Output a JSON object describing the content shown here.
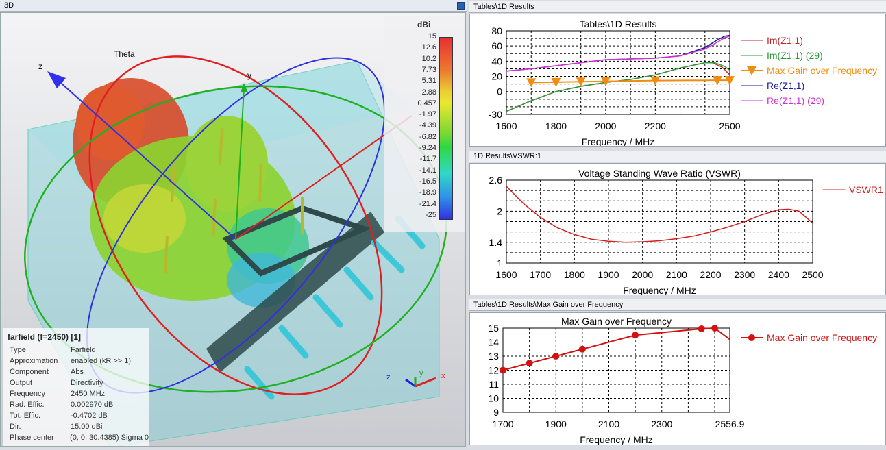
{
  "view3d": {
    "title": "3D",
    "axis_label_theta": "Theta",
    "axis_z": "z",
    "axis_y": "y",
    "axis_x": "x",
    "colorbar": {
      "unit": "dBi",
      "ticks": [
        "15",
        "12.6",
        "10.2",
        "7.73",
        "5.31",
        "2.88",
        "0.457",
        "-1.97",
        "-4.39",
        "-6.82",
        "-9.24",
        "-11.7",
        "-14.1",
        "-16.5",
        "-18.9",
        "-21.4",
        "-25"
      ]
    },
    "info": {
      "title": "farfield (f=2450) [1]",
      "rows": [
        {
          "k": "Type",
          "v": "Farfield"
        },
        {
          "k": "Approximation",
          "v": "enabled (kR >> 1)"
        },
        {
          "k": "Component",
          "v": "Abs"
        },
        {
          "k": "Output",
          "v": "Directivity"
        },
        {
          "k": "Frequency",
          "v": "2450 MHz"
        },
        {
          "k": "Rad. Effic.",
          "v": "0.002970 dB"
        },
        {
          "k": "Tot. Effic.",
          "v": "-0.4702 dB"
        },
        {
          "k": "Dir.",
          "v": "15.00 dBi"
        },
        {
          "k": "Phase center",
          "v": "(0, 0, 30.4385) Sigma 0"
        }
      ]
    }
  },
  "panels": {
    "p1": "Tables\\1D Results",
    "p2": "1D Results\\VSWR:1",
    "p3": "Tables\\1D Results\\Max Gain over Frequency"
  },
  "chart_data": [
    {
      "type": "line",
      "title": "Tables\\1D Results",
      "xlabel": "Frequency / MHz",
      "xlim": [
        1600,
        2500
      ],
      "ylim": [
        -30,
        80
      ],
      "xticks": [
        1600,
        1800,
        2000,
        2200,
        2500
      ],
      "yticks": [
        80,
        60,
        40,
        20,
        0,
        -30
      ],
      "xgrid": [
        1700,
        1800,
        1900,
        2000,
        2100,
        2200,
        2300,
        2400
      ],
      "ygrid": [
        70,
        60,
        50,
        40,
        30,
        20,
        10,
        0,
        -10,
        -20
      ],
      "series": [
        {
          "name": "Im(Z1,1)",
          "color": "#c0282c",
          "x": [
            1600,
            1700,
            1800,
            1900,
            2000,
            2100,
            2200,
            2300,
            2400,
            2430,
            2470,
            2500
          ],
          "y": [
            -26,
            -12,
            0,
            7,
            12,
            16,
            22,
            31,
            38,
            38,
            32,
            22
          ]
        },
        {
          "name": "Im(Z1,1) (29)",
          "color": "#2a9a3a",
          "x": [
            1600,
            1700,
            1800,
            1900,
            2000,
            2100,
            2200,
            2300,
            2400,
            2440,
            2480,
            2500
          ],
          "y": [
            -26,
            -12,
            0,
            7,
            12,
            16,
            22,
            31,
            38,
            38,
            33,
            28
          ]
        },
        {
          "name": "Max Gain over Frequency",
          "color": "#f08c10",
          "marker": "triangle",
          "x": [
            1700,
            1800,
            1900,
            2000,
            2200,
            2450,
            2500
          ],
          "y": [
            12,
            12.5,
            13,
            13.5,
            14.5,
            14.95,
            15
          ]
        },
        {
          "name": "Re(Z1,1)",
          "color": "#1a1a9a",
          "x": [
            1600,
            1700,
            1800,
            1900,
            2000,
            2100,
            2200,
            2300,
            2400,
            2450,
            2480,
            2500
          ],
          "y": [
            27,
            30,
            34,
            38,
            42,
            43,
            44,
            47,
            58,
            68,
            73,
            74
          ]
        },
        {
          "name": "Re(Z1,1) (29)",
          "color": "#d030d0",
          "x": [
            1600,
            1700,
            1800,
            1900,
            2000,
            2100,
            2200,
            2300,
            2400,
            2450,
            2480,
            2500
          ],
          "y": [
            27,
            30,
            34,
            38,
            42,
            43,
            44,
            47,
            56,
            65,
            71,
            73
          ]
        }
      ]
    },
    {
      "type": "line",
      "title": "Voltage Standing Wave Ratio (VSWR)",
      "xlabel": "Frequency / MHz",
      "xlim": [
        1600,
        2500
      ],
      "ylim": [
        1,
        2.6
      ],
      "xticks": [
        1600,
        1700,
        1800,
        1900,
        2000,
        2100,
        2200,
        2300,
        2400,
        2500
      ],
      "yticks": [
        2.6,
        2,
        1.4,
        1
      ],
      "xgrid": [
        1700,
        1800,
        1900,
        2000,
        2100,
        2200,
        2300,
        2400
      ],
      "ygrid": [
        2.4,
        2.2,
        2,
        1.8,
        1.6,
        1.4,
        1.2
      ],
      "series": [
        {
          "name": "VSWR1",
          "color": "#d42020",
          "x": [
            1600,
            1650,
            1700,
            1750,
            1800,
            1850,
            1900,
            1950,
            2000,
            2050,
            2100,
            2150,
            2200,
            2250,
            2300,
            2350,
            2400,
            2430,
            2460,
            2500
          ],
          "y": [
            2.48,
            2.15,
            1.88,
            1.68,
            1.55,
            1.46,
            1.42,
            1.4,
            1.41,
            1.43,
            1.47,
            1.52,
            1.6,
            1.69,
            1.8,
            1.93,
            2.03,
            2.04,
            2.0,
            1.77
          ]
        }
      ]
    },
    {
      "type": "line",
      "title": "Max Gain over Frequency",
      "xlabel": "Frequency / MHz",
      "xlim": [
        1700,
        2556.9
      ],
      "ylim": [
        9,
        15
      ],
      "xticks": [
        1700,
        1900,
        2100,
        2300,
        2556.9
      ],
      "yticks": [
        15,
        14,
        13,
        12,
        11,
        10,
        9
      ],
      "xgrid": [
        1800,
        1900,
        2000,
        2100,
        2200,
        2300,
        2400,
        2500
      ],
      "ygrid": [
        14,
        13,
        12,
        11,
        10
      ],
      "series": [
        {
          "name": "Max Gain over Frequency",
          "color": "#d41010",
          "marker": "circle",
          "x": [
            1700,
            1800,
            1900,
            2000,
            2200,
            2450,
            2500,
            2556.9
          ],
          "y": [
            12,
            12.5,
            13,
            13.5,
            14.5,
            14.95,
            15,
            14.2
          ],
          "markers_upto": 7
        }
      ]
    }
  ]
}
